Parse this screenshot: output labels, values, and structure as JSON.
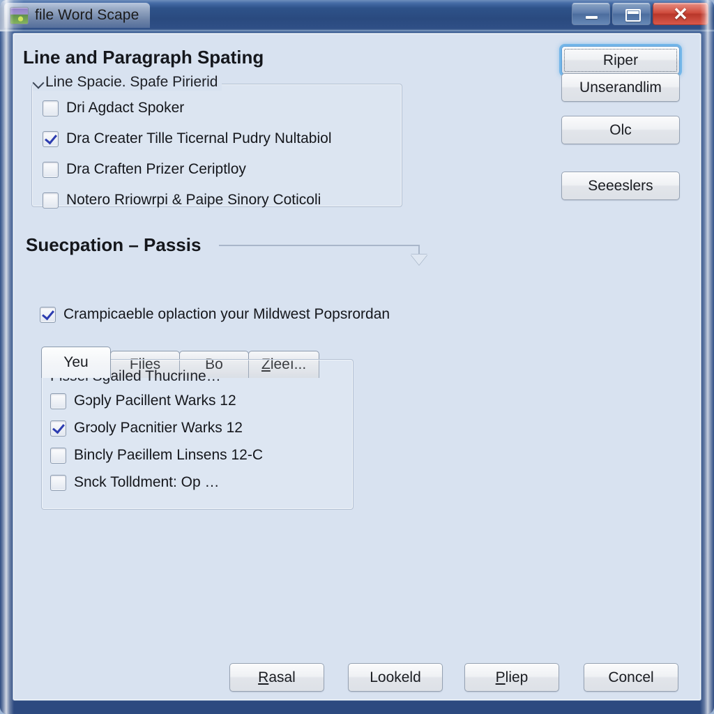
{
  "window": {
    "title": "file Word Scape",
    "icon": "image-photo-icon",
    "controls": {
      "minimize": "minimize-icon",
      "restore": "restore-icon",
      "close": "close-icon",
      "close_glyph": "✕"
    },
    "colors": {
      "titlebar_top": "#6f8fbd",
      "titlebar_bottom": "#2a4a7f",
      "client_background": "#d8e2f0",
      "close_button": "#cf4b3c",
      "focus_glow": "#6ab2e8",
      "checkmark": "#2c3cb0"
    }
  },
  "headings": {
    "main": "Line and Paragraph Spating",
    "spacing": "Suecpation – Passis"
  },
  "groupbox": {
    "legend": "Line Spacie. Spafe Pirierid",
    "legend_icon": "chevron-down-icon",
    "items": [
      {
        "label": "Dri Agdact Spoker",
        "checked": false
      },
      {
        "label": "Dra Creater Tille Ticernal Pudry Nultabiol",
        "checked": true
      },
      {
        "label": "Dra Craften Prizer Ceriptloy",
        "checked": false
      },
      {
        "label": "Notero Rriowrpi & Paipe Sinory Coticoli",
        "checked": false
      }
    ]
  },
  "spacing_option": {
    "label": "Crampicaeble oplaction your Mildwest Popsrordan",
    "checked": true,
    "rule_icon": "dropdown-arrow-icon"
  },
  "tabs": [
    {
      "label": "Yeu",
      "active": true,
      "mnemonic": ""
    },
    {
      "label": "Files",
      "active": false,
      "mnemonic": ""
    },
    {
      "label": "Bo",
      "active": false,
      "mnemonic": ""
    },
    {
      "label": "Zleeı...",
      "active": false,
      "mnemonic": "Z"
    }
  ],
  "list_panel": {
    "title": "Fissel Sgailed Thucriıne…",
    "items": [
      {
        "label": "Gɔply Pacillent Warks 12",
        "checked": false
      },
      {
        "label": "Grɔoly Pacnitier Warks 12",
        "checked": true
      },
      {
        "label": "Bincly Paєillem Linsens 12-C",
        "checked": false
      },
      {
        "label": "Snck Tolldment: Op  …",
        "checked": false
      }
    ]
  },
  "side_buttons": [
    {
      "label": "Riper",
      "focused": true
    },
    {
      "label": "Unserandlim",
      "focused": false
    },
    {
      "label": "Olc",
      "focused": false
    },
    {
      "label": "Seeeslers",
      "focused": false
    }
  ],
  "bottom_buttons": [
    {
      "label": "Rasal",
      "mnemonic": "R"
    },
    {
      "label": "Lookeld",
      "mnemonic": ""
    },
    {
      "label": "Pliep",
      "mnemonic": "P"
    },
    {
      "label": "Concel",
      "mnemonic": ""
    }
  ]
}
